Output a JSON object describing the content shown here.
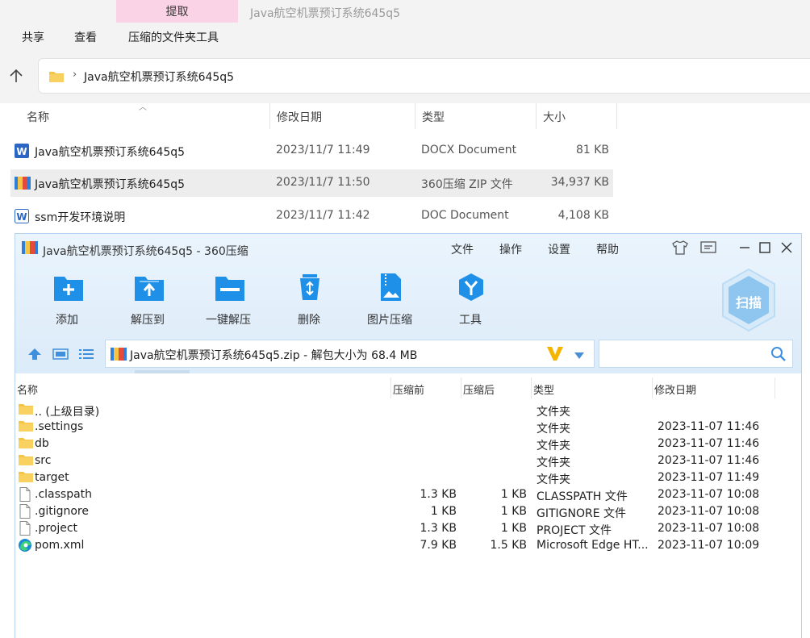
{
  "explorer": {
    "extract_tab": "提取",
    "window_title": "Java航空机票预订系统645q5",
    "ribbon": [
      "共享",
      "查看",
      "压缩的文件夹工具"
    ],
    "address_path": "Java航空机票预订系统645q5",
    "columns": [
      "名称",
      "修改日期",
      "类型",
      "大小"
    ],
    "files": [
      {
        "icon": "word-doc-icon",
        "name": "Java航空机票预订系统645q5",
        "date": "2023/11/7 11:49",
        "type": "DOCX Document",
        "size": "81 KB"
      },
      {
        "icon": "zip-archive-icon",
        "name": "Java航空机票预订系统645q5",
        "date": "2023/11/7 11:50",
        "type": "360压缩 ZIP 文件",
        "size": "34,937 KB"
      },
      {
        "icon": "word-doc-icon",
        "name": "ssm开发环境说明",
        "date": "2023/11/7 11:42",
        "type": "DOC Document",
        "size": "4,108 KB"
      }
    ]
  },
  "zip": {
    "title": "Java航空机票预订系统645q5 - 360压缩",
    "menu": [
      "文件",
      "操作",
      "设置",
      "帮助"
    ],
    "toolbar": [
      "添加",
      "解压到",
      "一键解压",
      "删除",
      "图片压缩",
      "工具"
    ],
    "scan_label": "扫描",
    "path": "Java航空机票预订系统645q5.zip - 解包大小为 68.4 MB",
    "search_placeholder": "",
    "columns": [
      "名称",
      "压缩前",
      "压缩后",
      "类型",
      "修改日期"
    ],
    "entries": [
      {
        "icon": "folder-icon",
        "name": ".. (上级目录)",
        "before": "",
        "after": "",
        "type": "文件夹",
        "date": ""
      },
      {
        "icon": "folder-icon",
        "name": ".settings",
        "before": "",
        "after": "",
        "type": "文件夹",
        "date": "2023-11-07 11:46"
      },
      {
        "icon": "folder-icon",
        "name": "db",
        "before": "",
        "after": "",
        "type": "文件夹",
        "date": "2023-11-07 11:46"
      },
      {
        "icon": "folder-icon",
        "name": "src",
        "before": "",
        "after": "",
        "type": "文件夹",
        "date": "2023-11-07 11:46"
      },
      {
        "icon": "folder-icon",
        "name": "target",
        "before": "",
        "after": "",
        "type": "文件夹",
        "date": "2023-11-07 11:49"
      },
      {
        "icon": "file-icon",
        "name": ".classpath",
        "before": "1.3 KB",
        "after": "1 KB",
        "type": "CLASSPATH 文件",
        "date": "2023-11-07 10:08"
      },
      {
        "icon": "file-icon",
        "name": ".gitignore",
        "before": "1 KB",
        "after": "1 KB",
        "type": "GITIGNORE 文件",
        "date": "2023-11-07 10:08"
      },
      {
        "icon": "file-icon",
        "name": ".project",
        "before": "1.3 KB",
        "after": "1 KB",
        "type": "PROJECT 文件",
        "date": "2023-11-07 10:08"
      },
      {
        "icon": "edge-icon",
        "name": "pom.xml",
        "before": "7.9 KB",
        "after": "1.5 KB",
        "type": "Microsoft Edge HT...",
        "date": "2023-11-07 10:09"
      }
    ]
  },
  "colors": {
    "accent": "#1e90e8",
    "tab_pink": "#fbd3e6",
    "folder": "#f6c445"
  }
}
